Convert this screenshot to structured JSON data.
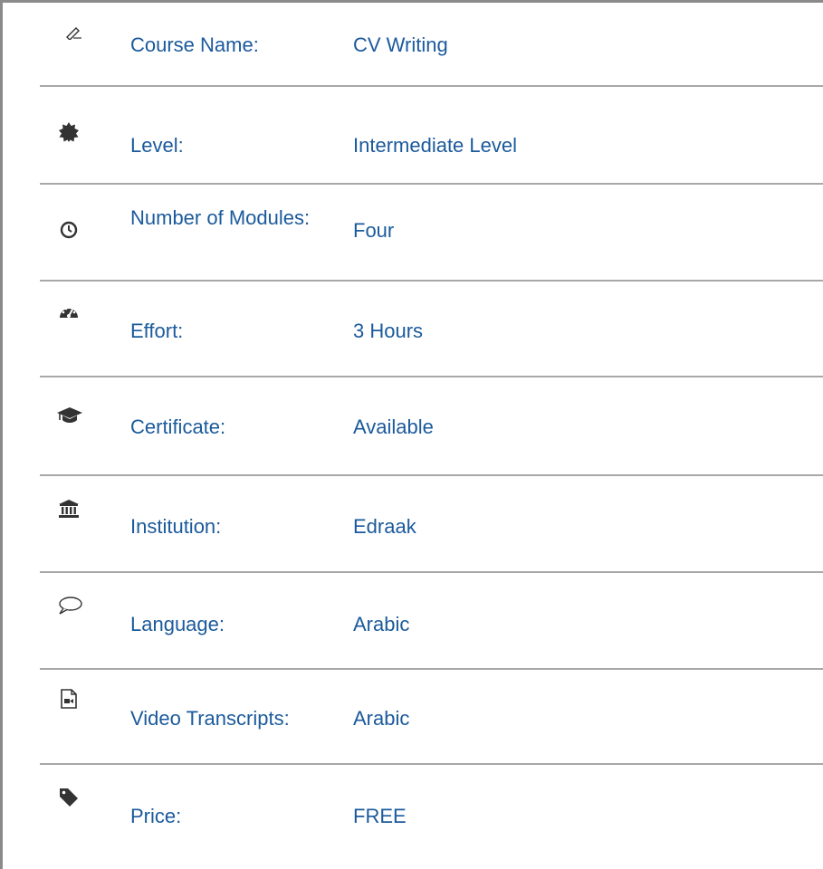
{
  "course_info": {
    "rows": [
      {
        "icon": "pen-icon",
        "label": "Course Name:",
        "value": "CV Writing"
      },
      {
        "icon": "badge-icon",
        "label": "Level:",
        "value": "Intermediate Level"
      },
      {
        "icon": "clock-icon",
        "label": "Number of Modules:",
        "value": "Four"
      },
      {
        "icon": "dashboard-icon",
        "label": "Effort:",
        "value": "3 Hours"
      },
      {
        "icon": "graduation-cap-icon",
        "label": "Certificate:",
        "value": "Available"
      },
      {
        "icon": "institution-icon",
        "label": "Institution:",
        "value": "Edraak"
      },
      {
        "icon": "speech-bubble-icon",
        "label": "Language:",
        "value": "Arabic"
      },
      {
        "icon": "video-file-icon",
        "label": "Video Transcripts:",
        "value": "Arabic"
      },
      {
        "icon": "tag-icon",
        "label": "Price:",
        "value": "FREE"
      }
    ]
  },
  "colors": {
    "text": "#1b5a9c",
    "icon": "#333333",
    "divider": "#a8a8a8",
    "frame": "#8a8a8a"
  }
}
